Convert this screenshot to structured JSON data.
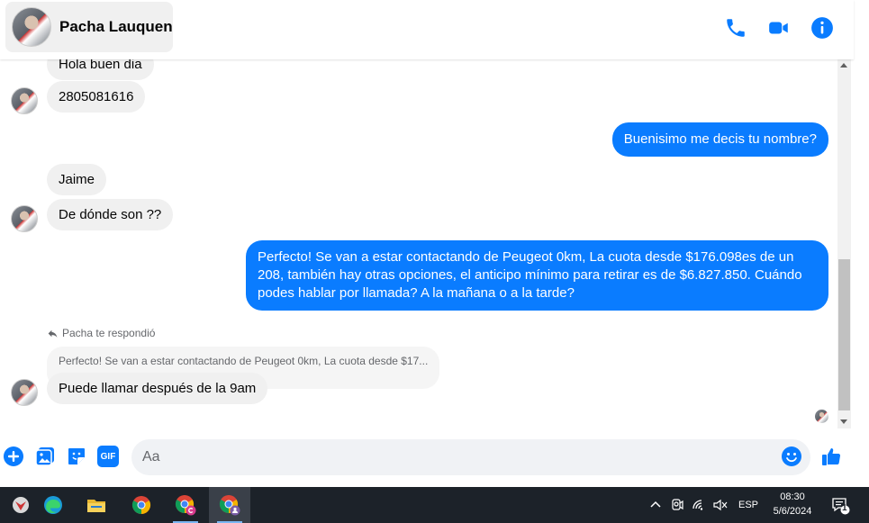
{
  "header": {
    "contact_name": "Pacha Lauquen",
    "icons": [
      "phone-icon",
      "video-icon",
      "info-icon"
    ],
    "accent": "#0a7cff"
  },
  "messages": {
    "m1": "Hola buen dia",
    "m2": "2805081616",
    "m3": "Buenisimo me decis tu nombre?",
    "m4": "Jaime",
    "m5": "De dónde son ??",
    "m6": "Perfecto!  Se van a estar contactando de Peugeot 0km, La cuota desde $176.098es de un 208, también hay otras opciones, el anticipo mínimo para retirar es de $6.827.850. Cuándo podes hablar por llamada? A la mañana o a la tarde?",
    "reply_label": "Pacha te respondió",
    "quoted": "Perfecto!  Se van a estar contactando de Peugeot 0km, La cuota desde $17...",
    "m7": "Puede llamar después de la 9am"
  },
  "composer": {
    "placeholder": "Aa",
    "icons": [
      "plus-icon",
      "gallery-icon",
      "sticker-icon",
      "gif-icon",
      "emoji-icon",
      "like-icon"
    ],
    "gif_label": "GIF"
  },
  "taskbar": {
    "apps": [
      "start-icon",
      "edge-icon",
      "file-explorer-icon",
      "chrome-icon",
      "chrome-profile-c-icon",
      "chrome-profile-active-icon"
    ],
    "language": "ESP",
    "time": "08:30",
    "date": "5/6/2024",
    "notification_count": "1"
  }
}
